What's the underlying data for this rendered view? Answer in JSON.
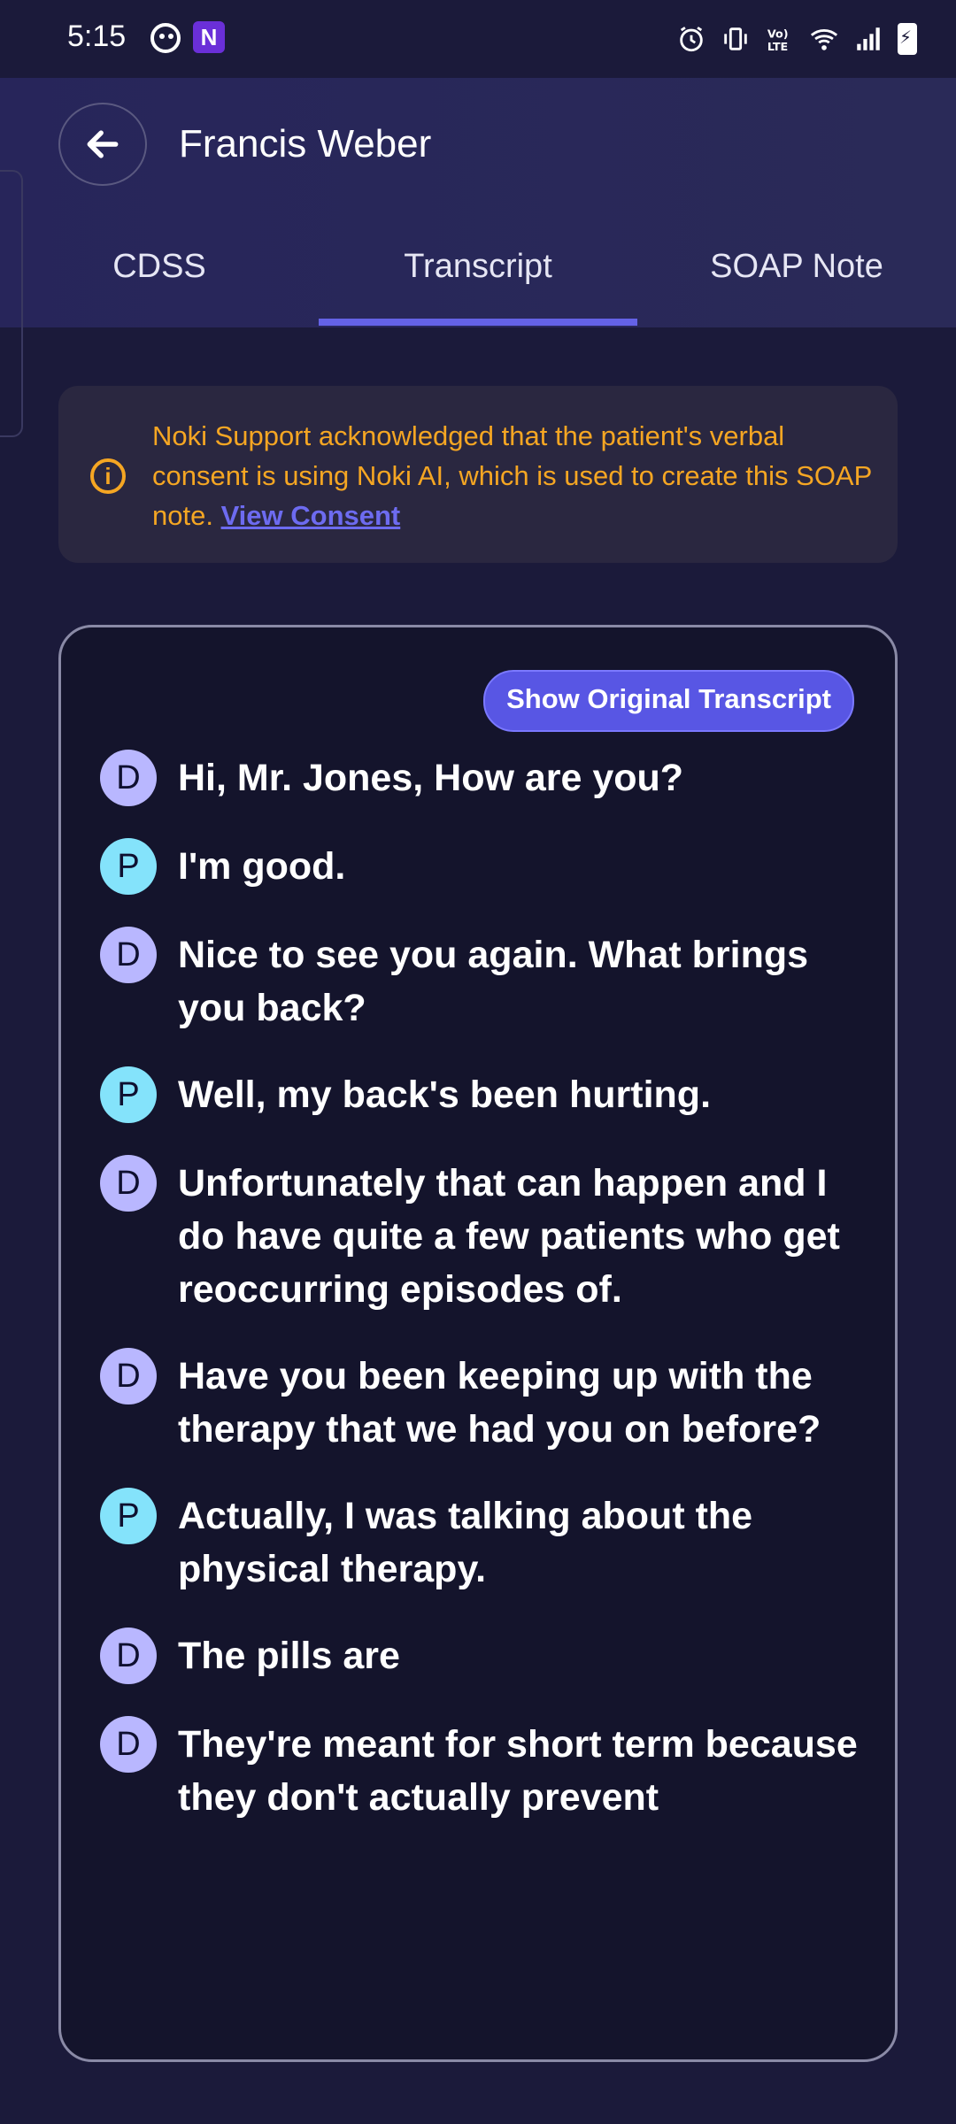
{
  "status_bar": {
    "time": "5:15",
    "icons": [
      "alarm-icon",
      "vibrate-icon",
      "volte-icon",
      "wifi-icon",
      "signal-icon",
      "battery-charging-icon"
    ]
  },
  "header": {
    "title": "Francis Weber",
    "tabs": [
      {
        "label": "CDSS",
        "active": false
      },
      {
        "label": "Transcript",
        "active": true
      },
      {
        "label": "SOAP Note",
        "active": false
      }
    ]
  },
  "notice": {
    "text": "Noki Support acknowledged that the patient's verbal consent is using Noki AI, which is used to create this SOAP note. ",
    "link": "View Consent",
    "color": "#f5a623"
  },
  "transcript": {
    "show_button": "Show Original Transcript",
    "lines": [
      {
        "speaker": "D",
        "text": "Hi, Mr. Jones, How are you?"
      },
      {
        "speaker": "P",
        "text": "I'm good."
      },
      {
        "speaker": "D",
        "text": "Nice to see you again. What brings you back?"
      },
      {
        "speaker": "P",
        "text": "Well, my back's been hurting."
      },
      {
        "speaker": "D",
        "text": "Unfortunately that can happen and I do have quite a few patients who get reoccurring episodes of."
      },
      {
        "speaker": "D",
        "text": "Have you been keeping up with the therapy that we had you on before?"
      },
      {
        "speaker": "P",
        "text": "Actually, I was talking about the physical therapy."
      },
      {
        "speaker": "D",
        "text": "The pills are"
      },
      {
        "speaker": "D",
        "text": "They're meant for short term because they don't actually prevent"
      }
    ]
  }
}
